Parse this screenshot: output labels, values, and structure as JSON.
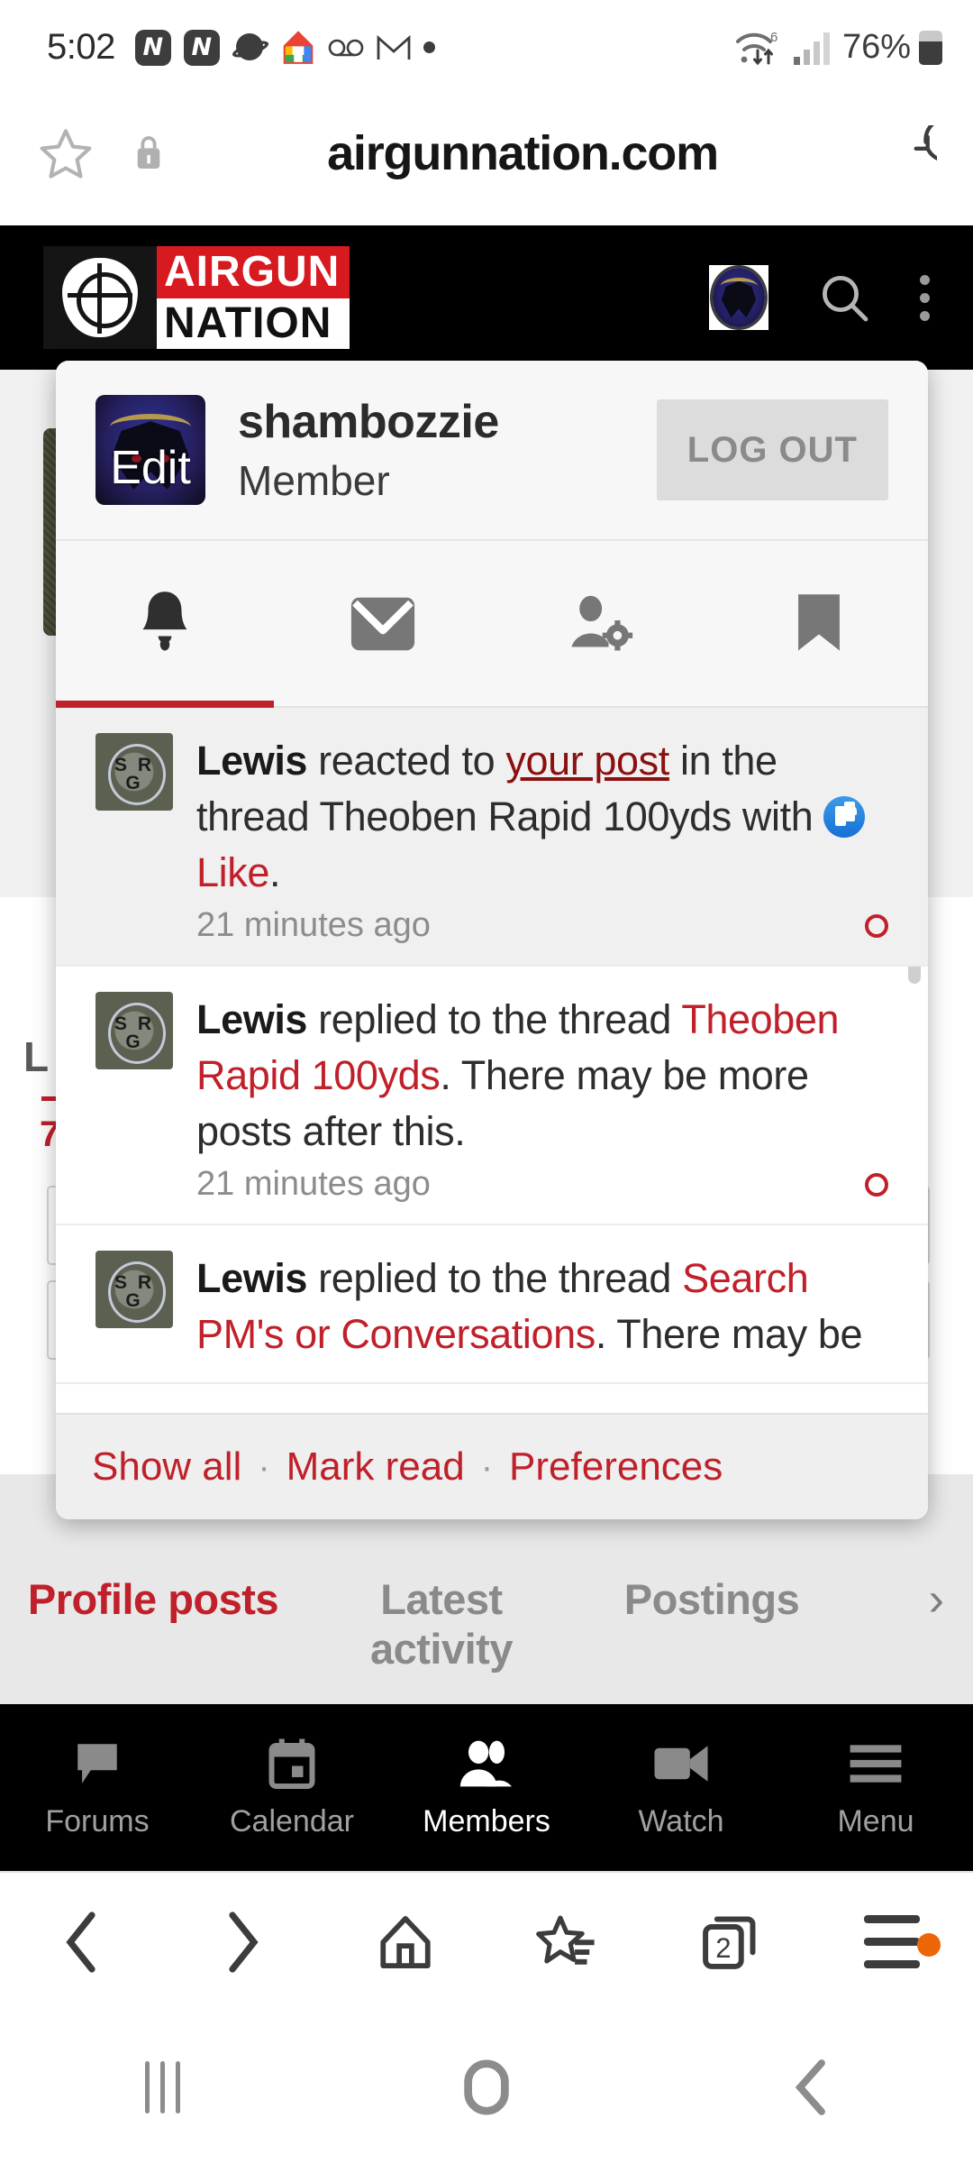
{
  "status_bar": {
    "time": "5:02",
    "icons": [
      "nitro-app-icon",
      "nitro-app-icon",
      "saturn-icon",
      "google-home-icon",
      "voicemail-icon",
      "gmail-icon",
      "dot-icon"
    ],
    "wifi": "wifi-6-icon",
    "signal": "cellular-signal-icon",
    "battery_percent": "76%",
    "battery_icon": "battery-icon"
  },
  "url_bar": {
    "star_icon": "bookmark-star-icon",
    "lock_icon": "https-lock-icon",
    "domain": "airgunnation.com",
    "reload_icon": "reload-icon"
  },
  "site_header": {
    "logo_top": "AIRGUN",
    "logo_bottom": "NATION",
    "logo_mark": "crosshair-icon",
    "avatar_icon": "user-avatar-raven",
    "search_icon": "search-icon",
    "overflow_icon": "kebab-menu-icon"
  },
  "account_dropdown": {
    "username": "shambozzie",
    "user_title": "Member",
    "avatar_edit_label": "Edit",
    "logout_label": "LOG OUT",
    "tabs": [
      {
        "name": "alerts-tab",
        "icon": "bell-icon",
        "selected": true
      },
      {
        "name": "conversations-tab",
        "icon": "envelope-icon",
        "selected": false
      },
      {
        "name": "account-settings-tab",
        "icon": "user-gear-icon",
        "selected": false
      },
      {
        "name": "bookmarks-tab",
        "icon": "bookmark-icon",
        "selected": false
      }
    ],
    "notifications": [
      {
        "actor": "Lewis",
        "action_pre": " reacted to ",
        "link_text": "your post",
        "action_mid": " in the thread Theoben Rapid 100yds with ",
        "reaction_icon": "facebook-like-icon",
        "reaction_label": "Like",
        "trailing": ".",
        "time": "21 minutes ago",
        "unread": true
      },
      {
        "actor": "Lewis",
        "action_pre": " replied to the thread ",
        "thread_title": "Theoben Rapid 100yds",
        "action_post": ". There may be more posts after this.",
        "time": "21 minutes ago",
        "unread": false
      },
      {
        "actor": "Lewis",
        "action_pre": " replied to the thread ",
        "thread_title": "Search PM's or Conversations",
        "action_post": ". There may be",
        "time": "",
        "unread": false
      }
    ],
    "footer_links": [
      "Show all",
      "Mark read",
      "Preferences"
    ],
    "footer_separator": "·"
  },
  "profile_tabs": [
    {
      "label": "Profile posts",
      "active": true
    },
    {
      "label": "Latest activity",
      "active": false
    },
    {
      "label": "Postings",
      "active": false
    }
  ],
  "profile_tabs_chevron": "chevron-right-icon",
  "site_nav": [
    {
      "label": "Forums",
      "icon": "speech-bubble-icon",
      "active": false
    },
    {
      "label": "Calendar",
      "icon": "calendar-icon",
      "active": false
    },
    {
      "label": "Members",
      "icon": "people-icon",
      "active": true
    },
    {
      "label": "Watch",
      "icon": "video-camera-icon",
      "active": false
    },
    {
      "label": "Menu",
      "icon": "hamburger-icon",
      "active": false
    }
  ],
  "browser_toolbar": {
    "back_icon": "chevron-left-icon",
    "forward_icon": "chevron-right-icon",
    "home_icon": "home-icon",
    "bookmarks_icon": "star-list-icon",
    "tabs_icon": "tab-switcher-icon",
    "tab_count": "2",
    "menu_icon": "hamburger-menu-icon",
    "menu_badge": "update-dot"
  },
  "system_nav": {
    "recents_icon": "recents-icon",
    "home_icon": "home-pill-icon",
    "back_icon": "back-chevron-icon"
  },
  "colors": {
    "brand_red": "#c0202a",
    "header_black": "#000000",
    "accent_orange": "#ec6608",
    "link_red": "#8b1010"
  }
}
